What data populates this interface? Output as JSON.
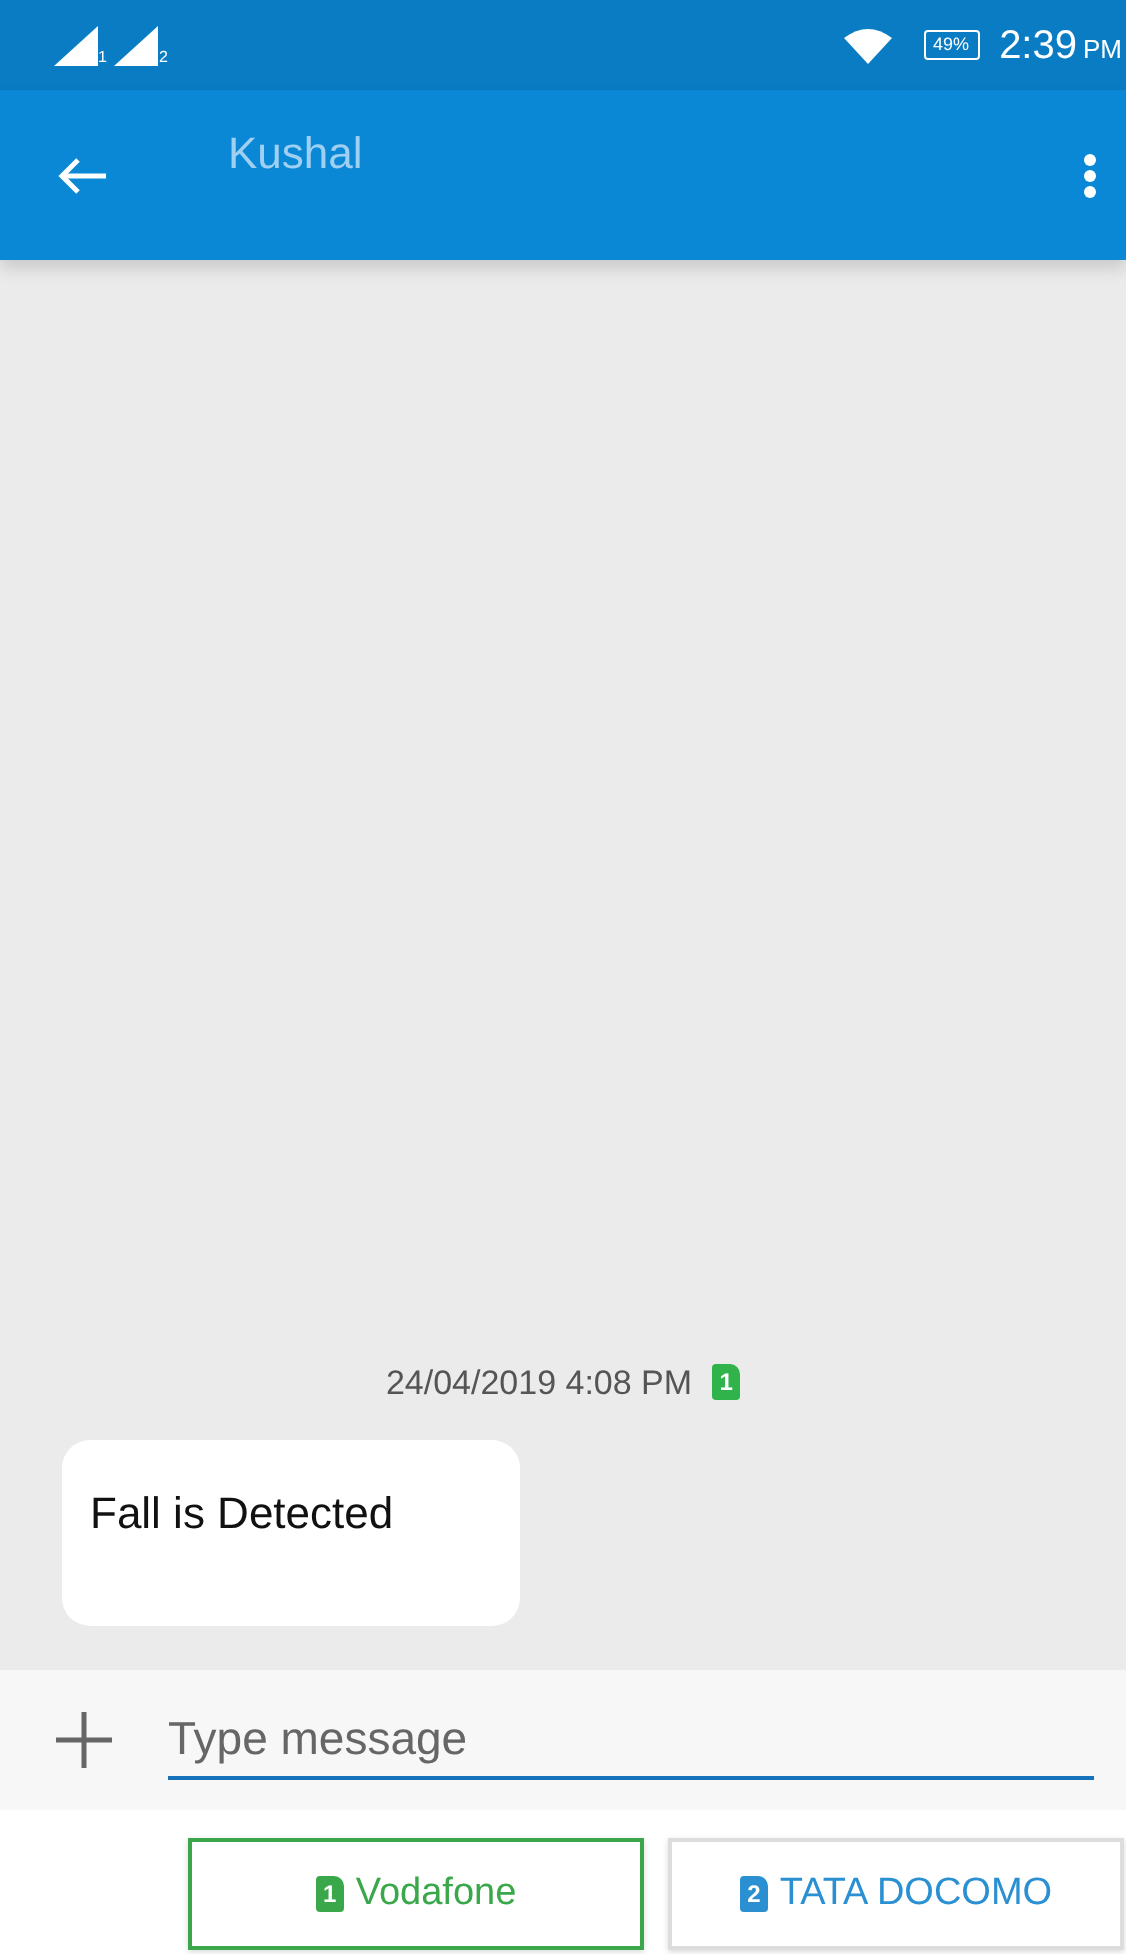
{
  "status_bar": {
    "signal_labels": [
      "1",
      "2"
    ],
    "battery": "49%",
    "time": "2:39",
    "meridiem": "PM"
  },
  "app_bar": {
    "contact_name": "Kushal"
  },
  "messages": [
    {
      "timestamp": "24/04/2019 4:08 PM",
      "sim": "1",
      "text": "Fall is Detected"
    }
  ],
  "composer": {
    "placeholder": "Type message"
  },
  "sim_buttons": [
    {
      "sim": "1",
      "label": "Vodafone",
      "color": "#3aa84a",
      "selected": true
    },
    {
      "sim": "2",
      "label": "TATA DOCOMO",
      "color": "#2a90d2",
      "selected": false
    }
  ]
}
